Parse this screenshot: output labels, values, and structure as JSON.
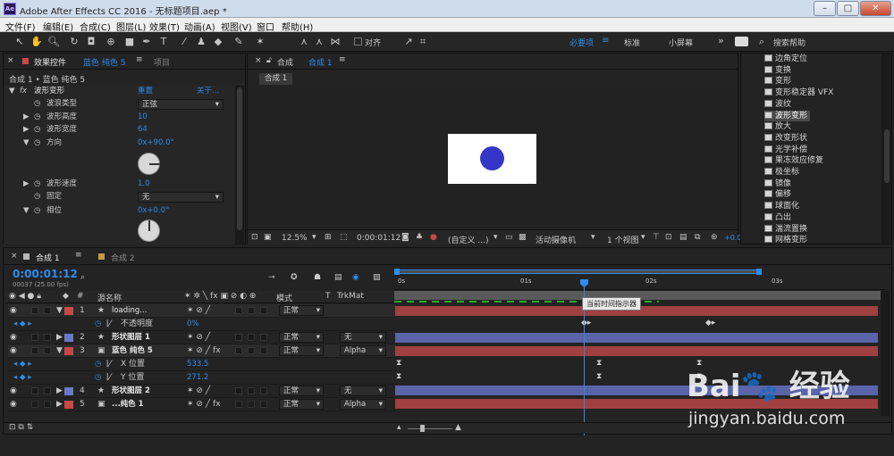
{
  "window": {
    "title": "Adobe After Effects CC 2016 - 无标题项目.aep *",
    "app_icon": "Ae"
  },
  "menu": [
    "文件(F)",
    "编辑(E)",
    "合成(C)",
    "图层(L)",
    "效果(T)",
    "动画(A)",
    "视图(V)",
    "窗口",
    "帮助(H)"
  ],
  "toolbar": {
    "snap_label": "对齐",
    "workspace_active": "必要项",
    "workspace_2": "标准",
    "workspace_3": "小屏幕",
    "more": "»",
    "search_help": "搜索帮助"
  },
  "effect_controls": {
    "tab_label": "效果控件",
    "tab_layer": "蓝色 纯色 5",
    "menu": "≡",
    "project_tab": "项目",
    "breadcrumb": "合成 1 • 蓝色 纯色 5",
    "effect_name": "波形变形",
    "reset": "重置",
    "about": "关于...",
    "props": [
      {
        "label": "波浪类型",
        "value": "正弦",
        "type": "select"
      },
      {
        "label": "波形高度",
        "value": "10"
      },
      {
        "label": "波形宽度",
        "value": "64"
      },
      {
        "label": "方向",
        "value": "0x+90.0°",
        "dial_degrees": 90
      },
      {
        "label": "波形速度",
        "value": "1.0"
      },
      {
        "label": "固定",
        "value": "无",
        "type": "select"
      },
      {
        "label": "相位",
        "value": "0x+0.0°",
        "dial_degrees": 0
      }
    ]
  },
  "composition": {
    "tab_prefix": "合成",
    "tab_name": "合成 1",
    "menu": "≡",
    "flow_tab": "合成 1",
    "zoom": "12.5%",
    "timecode": "0:00:01:12",
    "resolution": "(自定义 ...)",
    "camera": "活动摄像机",
    "views": "1 个视图",
    "exposure": "+0.0",
    "circle_color": "#3535c8"
  },
  "effects_list": [
    "边角定位",
    "变换",
    "变形",
    "变形稳定器 VFX",
    "波纹",
    "波形变形",
    "放大",
    "改变形状",
    "光学补偿",
    "果冻效应修复",
    "极坐标",
    "镜像",
    "偏移",
    "球面化",
    "凸出",
    "湍流置换",
    "网格变形"
  ],
  "effects_selected": 5,
  "timeline": {
    "tab_name": "合成 1",
    "tab2_name": "合成 2",
    "menu": "≡",
    "timecode": "0:00:01:12",
    "frame_info": "00037 (25.00 fps)",
    "col_num": "#",
    "col_source": "源名称",
    "col_mode": "模式",
    "col_t": "T",
    "col_trkmat": "TrkMat",
    "ruler": [
      "0s",
      "01s",
      "02s",
      "03s"
    ],
    "tooltip": "当前时间指示器",
    "layers": [
      {
        "num": "1",
        "name": "loading...",
        "color": "#c84848",
        "mode": "正常",
        "trk": ""
      },
      {
        "prop": "不透明度",
        "value": "0%"
      },
      {
        "num": "2",
        "name": "形状图层 1",
        "color": "#6a78c8",
        "mode": "正常",
        "trk": "无"
      },
      {
        "num": "3",
        "name": "蓝色 纯色 5",
        "color": "#c84848",
        "mode": "正常",
        "trk": "Alpha"
      },
      {
        "prop": "X 位置",
        "value": "533.5"
      },
      {
        "prop": "Y 位置",
        "value": "271.2"
      },
      {
        "num": "4",
        "name": "形状图层 2",
        "color": "#6a78c8",
        "mode": "正常",
        "trk": "无"
      },
      {
        "num": "5",
        "name": "...纯色 1",
        "color": "#c84848",
        "mode": "正常",
        "trk": "Alpha"
      }
    ]
  },
  "watermark": {
    "logo": "Bai 经验",
    "url": "jingyan.baidu.com"
  }
}
